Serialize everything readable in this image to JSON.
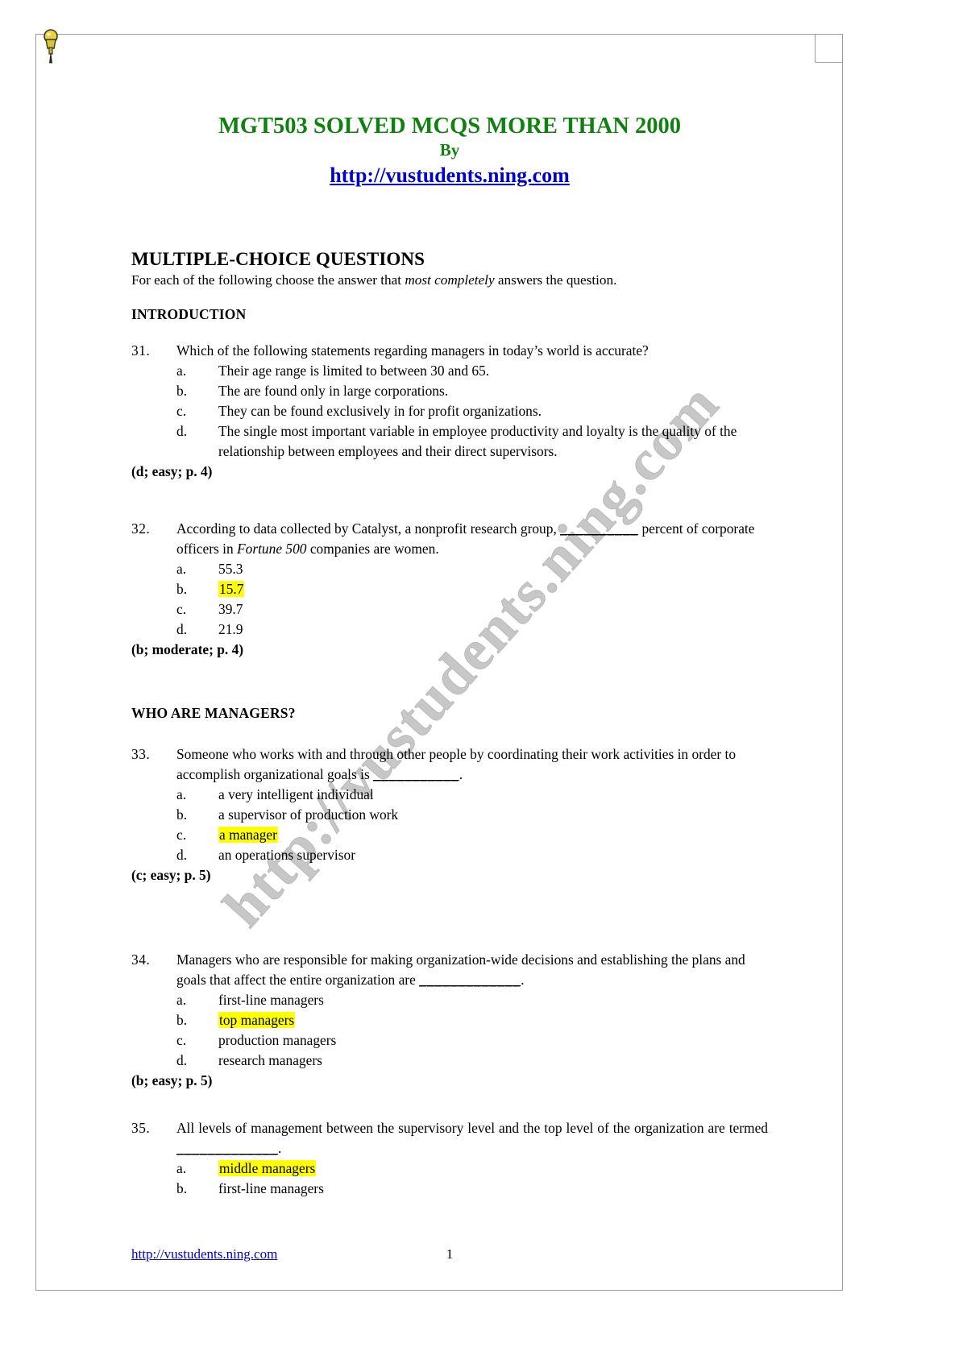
{
  "document": {
    "title": "MGT503 SOLVED MCQS MORE THAN 2000",
    "by_label": "By",
    "site_url": "http://vustudents.ning.com",
    "watermark_text": "http://vustudents.ning.com",
    "section_heading": "MULTIPLE-CHOICE QUESTIONS",
    "instruction_prefix": "For each of the following choose the answer that ",
    "instruction_italic": "most completely",
    "instruction_suffix": " answers the question.",
    "heading_introduction": "INTRODUCTION",
    "heading_who_are_managers": "WHO ARE MANAGERS?"
  },
  "questions": [
    {
      "number": "31.",
      "text": "Which of the following statements regarding managers in today’s world is accurate?",
      "options": [
        {
          "letter": "a.",
          "text": "Their age range is limited to between 30 and 65.",
          "highlighted": false
        },
        {
          "letter": "b.",
          "text": "The are found only in large corporations.",
          "highlighted": false
        },
        {
          "letter": "c.",
          "text": "They can be found exclusively in for profit organizations.",
          "highlighted": false
        },
        {
          "letter": "d.",
          "text": "The single most important variable in employee productivity and loyalty is the quality of the relationship between employees and their direct supervisors.",
          "highlighted": false
        }
      ],
      "answer": "(d; easy; p. 4)"
    },
    {
      "number": "32.",
      "text_part1": "According to data collected by Catalyst, a nonprofit research group, ",
      "text_blank": "__________",
      "text_part2": " percent of corporate officers in ",
      "text_italic": "Fortune 500",
      "text_part3": " companies are women.",
      "options": [
        {
          "letter": "a.",
          "text": "55.3",
          "highlighted": false
        },
        {
          "letter": "b.",
          "text": "15.7",
          "highlighted": true
        },
        {
          "letter": "c.",
          "text": "39.7",
          "highlighted": false
        },
        {
          "letter": "d.",
          "text": "21.9",
          "highlighted": false
        }
      ],
      "answer": "(b; moderate; p. 4)"
    },
    {
      "number": "33.",
      "text_part1": "Someone who works with and through other people by coordinating their work activities in order to accomplish organizational goals is ",
      "text_blank": "___________",
      "text_part2": ".",
      "options": [
        {
          "letter": "a.",
          "text": "a very intelligent individual",
          "highlighted": false
        },
        {
          "letter": "b.",
          "text": "a supervisor of production work",
          "highlighted": false
        },
        {
          "letter": "c.",
          "text": "a manager",
          "highlighted": true
        },
        {
          "letter": "d.",
          "text": "an operations supervisor",
          "highlighted": false
        }
      ],
      "answer": "(c; easy; p. 5)"
    },
    {
      "number": "34.",
      "text_part1": "Managers who are responsible for making organization-wide decisions and establishing the plans and goals that affect the entire organization are ",
      "text_blank": "_____________",
      "text_part2": ".",
      "options": [
        {
          "letter": "a.",
          "text": "first-line managers",
          "highlighted": false
        },
        {
          "letter": "b.",
          "text": "top managers",
          "highlighted": true
        },
        {
          "letter": "c.",
          "text": "production managers",
          "highlighted": false
        },
        {
          "letter": "d.",
          "text": "research managers",
          "highlighted": false
        }
      ],
      "answer": "(b; easy; p. 5)"
    },
    {
      "number": "35.",
      "text_part1": "All levels of management between the supervisory level and the top level of the organization are termed ",
      "text_blank": "_____________",
      "text_part2": ".",
      "options": [
        {
          "letter": "a.",
          "text": "middle managers",
          "highlighted": true
        },
        {
          "letter": "b.",
          "text": "first-line managers",
          "highlighted": false
        }
      ],
      "answer": ""
    }
  ],
  "footer": {
    "url": "http://vustudents.ning.com",
    "page_number": "1"
  },
  "colors": {
    "title_green": "#108010",
    "link_blue": "#0000cc",
    "highlight_yellow": "#ffff00"
  }
}
